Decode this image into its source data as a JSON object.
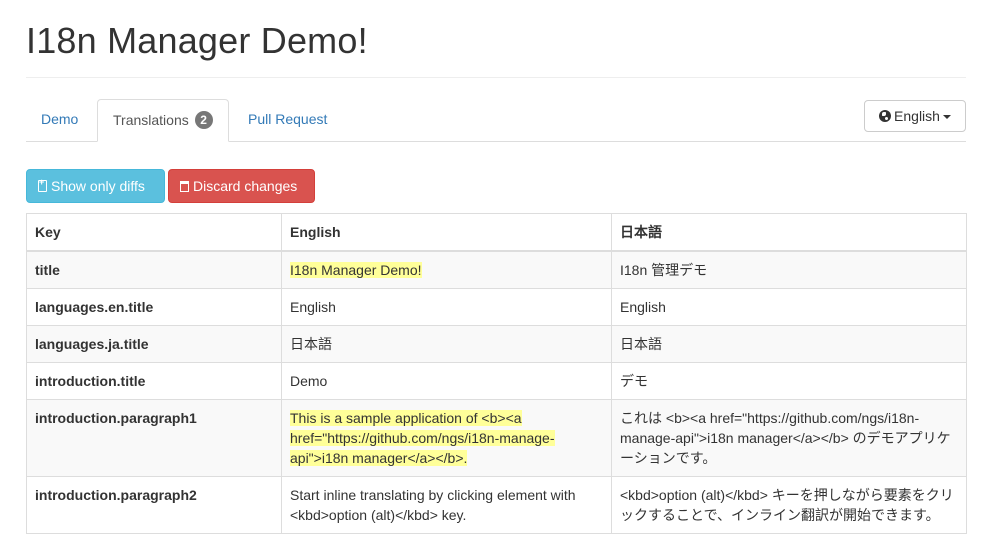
{
  "header": {
    "title": "I18n Manager Demo!"
  },
  "tabs": [
    {
      "label": "Demo",
      "active": false
    },
    {
      "label": "Translations",
      "active": true,
      "badge": "2"
    },
    {
      "label": "Pull Request",
      "active": false
    }
  ],
  "language_select": {
    "label": "English",
    "icon": "globe-icon"
  },
  "toolbar": {
    "show_diffs_label": "Show only diffs",
    "discard_label": "Discard changes"
  },
  "colors": {
    "info": "#5bc0de",
    "danger": "#d9534f",
    "link": "#337ab7",
    "highlight": "#ffff99"
  },
  "table": {
    "columns": [
      "Key",
      "English",
      "日本語"
    ],
    "rows": [
      {
        "key": "title",
        "en": "I18n Manager Demo!",
        "ja": "I18n 管理デモ",
        "changed": true
      },
      {
        "key": "languages.en.title",
        "en": "English",
        "ja": "English",
        "changed": false
      },
      {
        "key": "languages.ja.title",
        "en": "日本語",
        "ja": "日本語",
        "changed": false
      },
      {
        "key": "introduction.title",
        "en": "Demo",
        "ja": "デモ",
        "changed": false
      },
      {
        "key": "introduction.paragraph1",
        "en": "This is a sample application of <b><a href=\"https://github.com/ngs/i18n-manage-api\">i18n manager</a></b>.",
        "ja": "これは <b><a href=\"https://github.com/ngs/i18n-manage-api\">i18n manager</a></b> のデモアプリケーションです。",
        "changed": true
      },
      {
        "key": "introduction.paragraph2",
        "en": "Start inline translating by clicking element with <kbd>option (alt)</kbd> key.",
        "ja": "<kbd>option (alt)</kbd> キーを押しながら要素をクリックすることで、インライン翻訳が開始できます。",
        "changed": false
      }
    ]
  }
}
